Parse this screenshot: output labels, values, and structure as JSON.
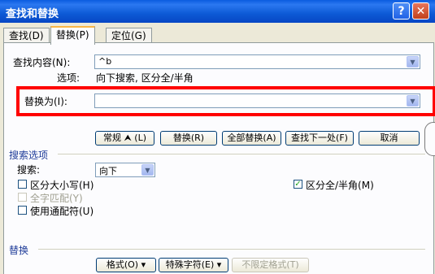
{
  "titlebar": {
    "title": "查找和替换",
    "help": "?",
    "close": "✕"
  },
  "tabs": [
    {
      "label": "查找(D)"
    },
    {
      "label": "替换(P)"
    },
    {
      "label": "定位(G)"
    }
  ],
  "find": {
    "label": "查找内容(N):",
    "value": "^b"
  },
  "options_summary": {
    "label": "选项:",
    "value": "向下搜索, 区分全/半角"
  },
  "replace": {
    "label": "替换为(I):",
    "value": ""
  },
  "buttons": {
    "less": "常规 ⮝ (L)",
    "replace": "替换(R)",
    "replace_all": "全部替换(A)",
    "find_next": "查找下一处(F)",
    "cancel": "取消"
  },
  "search_options": {
    "title": "搜索选项",
    "search_label": "搜索:",
    "direction": "向下",
    "match_case": {
      "label": "区分大小写(H)",
      "checked": false
    },
    "whole_word": {
      "label": "全字匹配(Y)",
      "checked": false,
      "disabled": true
    },
    "wildcards": {
      "label": "使用通配符(U)",
      "checked": false
    },
    "width": {
      "label": "区分全/半角(M)",
      "checked": true
    }
  },
  "replace_section": {
    "title": "替换",
    "format": "格式(O) ▾",
    "special": "特殊字符(E) ▾",
    "no_format": "不限定格式(T)"
  }
}
